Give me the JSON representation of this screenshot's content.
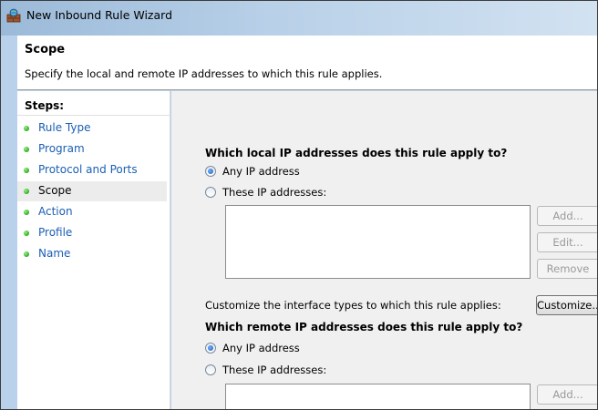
{
  "window": {
    "title": "New Inbound Rule Wizard",
    "icon": "firewall-icon"
  },
  "header": {
    "title": "Scope",
    "subtitle": "Specify the local and remote IP addresses to which this rule applies."
  },
  "steps": {
    "title": "Steps:",
    "items": [
      {
        "label": "Rule Type",
        "active": false
      },
      {
        "label": "Program",
        "active": false
      },
      {
        "label": "Protocol and Ports",
        "active": false
      },
      {
        "label": "Scope",
        "active": true
      },
      {
        "label": "Action",
        "active": false
      },
      {
        "label": "Profile",
        "active": false
      },
      {
        "label": "Name",
        "active": false
      }
    ]
  },
  "local": {
    "question": "Which local IP addresses does this rule apply to?",
    "option_any": "Any IP address",
    "option_these": "These IP addresses:",
    "selected": "any",
    "add_label": "Add...",
    "edit_label": "Edit...",
    "remove_label": "Remove"
  },
  "customize": {
    "text": "Customize the interface types to which this rule applies:",
    "button_label": "Customize..."
  },
  "remote": {
    "question": "Which remote IP addresses does this rule apply to?",
    "option_any": "Any IP address",
    "option_these": "These IP addresses:",
    "selected": "any",
    "add_label": "Add..."
  }
}
